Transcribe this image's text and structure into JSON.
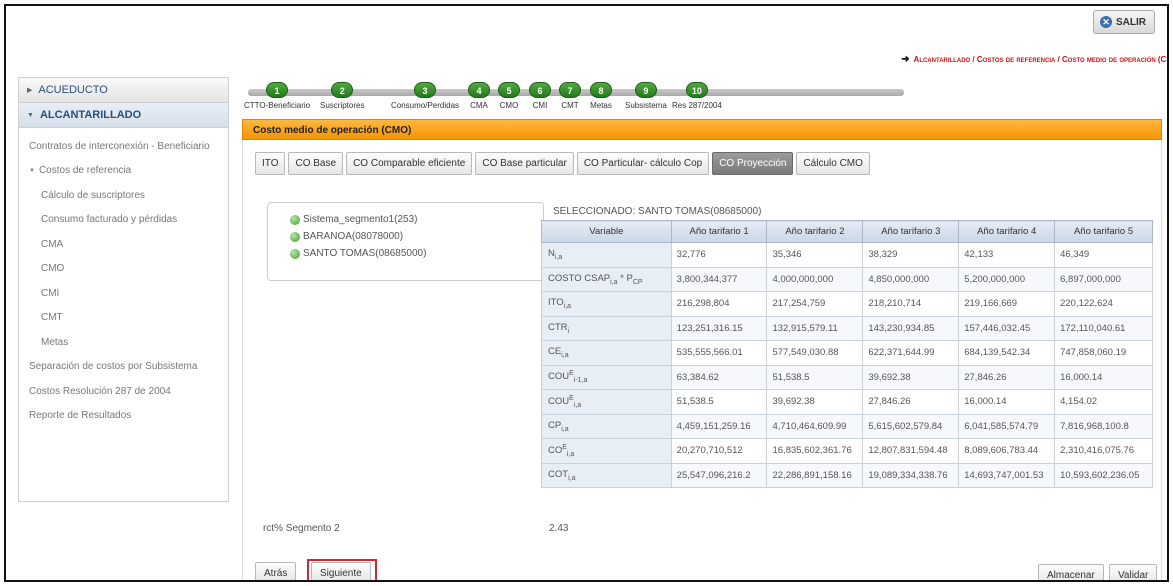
{
  "header": {
    "exit_label": "SALIR"
  },
  "breadcrumb": {
    "text": "Alcantarillado / Costos de referencia / Costo medio de operación (CM"
  },
  "sidebar": {
    "sections": [
      {
        "label": "ACUEDUCTO",
        "expanded": false
      },
      {
        "label": "ALCANTARILLADO",
        "expanded": true
      }
    ],
    "items": [
      {
        "label": "Contratos de interconexión - Beneficiario",
        "level": 0
      },
      {
        "label": "Costos de referencia",
        "level": 0
      },
      {
        "label": "Cálculo de suscriptores",
        "level": 1
      },
      {
        "label": "Consumo facturado y pérdidas",
        "level": 1
      },
      {
        "label": "CMA",
        "level": 1
      },
      {
        "label": "CMO",
        "level": 1
      },
      {
        "label": "CMI",
        "level": 1
      },
      {
        "label": "CMT",
        "level": 1
      },
      {
        "label": "Metas",
        "level": 1
      },
      {
        "label": "Separación de costos por Subsistema",
        "level": 0
      },
      {
        "label": "Costos Resolución 287 de 2004",
        "level": 0
      },
      {
        "label": "Reporte de Resultados",
        "level": 0
      }
    ]
  },
  "steps": [
    {
      "num": "1",
      "label": "CTTO-Beneficiario"
    },
    {
      "num": "2",
      "label": "Suscriptores"
    },
    {
      "num": "3",
      "label": "Consumo/Perdidas"
    },
    {
      "num": "4",
      "label": "CMA"
    },
    {
      "num": "5",
      "label": "CMO"
    },
    {
      "num": "6",
      "label": "CMI"
    },
    {
      "num": "7",
      "label": "CMT"
    },
    {
      "num": "8",
      "label": "Metas"
    },
    {
      "num": "9",
      "label": "Subsistema"
    },
    {
      "num": "10",
      "label": "Res 287/2004"
    }
  ],
  "panel": {
    "title": "Costo medio de operación (CMO)"
  },
  "tabs": [
    {
      "label": "ITO",
      "active": false
    },
    {
      "label": "CO Base",
      "active": false
    },
    {
      "label": "CO Comparable eficiente",
      "active": false
    },
    {
      "label": "CO Base particular",
      "active": false
    },
    {
      "label": "CO Particular- cálculo Cop",
      "active": false
    },
    {
      "label": "CO Proyección",
      "active": true
    },
    {
      "label": "Cálculo CMO",
      "active": false
    }
  ],
  "tree": {
    "nodes": [
      "Sistema_segmento1(253)",
      "BARANOA(08078000)",
      "SANTO TOMAS(08685000)"
    ]
  },
  "table": {
    "selected_label": "SELECCIONADO: SANTO TOMAS(08685000)",
    "headers": [
      "Variable",
      "Año tarifario 1",
      "Año tarifario 2",
      "Año tarifario 3",
      "Año tarifario 4",
      "Año tarifario 5"
    ],
    "rows": [
      {
        "var_main": "N",
        "var_sub": "i,a",
        "var_suffix": "",
        "values": [
          "32,776",
          "35,346",
          "38,329",
          "42,133",
          "46,349"
        ]
      },
      {
        "var_main": "COSTO CSAP",
        "var_sub": "i,a",
        "var_suffix": " * P",
        "var_sub2": "CP",
        "values": [
          "3,800,344,377",
          "4,000,000,000",
          "4,850,000,000",
          "5,200,000,000",
          "6,897,000,000"
        ]
      },
      {
        "var_main": "ITO",
        "var_sub": "i,a",
        "var_suffix": "",
        "values": [
          "216,298,804",
          "217,254,759",
          "218,210,714",
          "219,166,669",
          "220,122,624"
        ]
      },
      {
        "var_main": "CTR",
        "var_sub": "i",
        "var_suffix": "",
        "values": [
          "123,251,316.15",
          "132,915,579.11",
          "143,230,934.85",
          "157,446,032.45",
          "172,110,040.61"
        ]
      },
      {
        "var_main": "CE",
        "var_sub": "i,a",
        "var_suffix": "",
        "values": [
          "535,555,566.01",
          "577,549,030.88",
          "622,371,644.99",
          "684,139,542.34",
          "747,858,060.19"
        ]
      },
      {
        "var_main": "COU",
        "var_sup": "E",
        "var_sub": "i-1,a",
        "var_suffix": "",
        "values": [
          "63,384.62",
          "51,538.5",
          "39,692.38",
          "27,846.26",
          "16,000.14"
        ]
      },
      {
        "var_main": "COU",
        "var_sup": "E",
        "var_sub": "i,a",
        "var_suffix": "",
        "values": [
          "51,538.5",
          "39,692.38",
          "27,846.26",
          "16,000.14",
          "4,154.02"
        ]
      },
      {
        "var_main": "CP",
        "var_sub": "i,a",
        "var_suffix": "",
        "values": [
          "4,459,151,259.16",
          "4,710,464,609.99",
          "5,615,602,579.84",
          "6,041,585,574.79",
          "7,816,968,100.8"
        ]
      },
      {
        "var_main": "CO",
        "var_sup": "E",
        "var_sub": "i,a",
        "var_suffix": "",
        "values": [
          "20,270,710,512",
          "16,835,602,361.76",
          "12,807,831,594.48",
          "8,089,606,783.44",
          "2,310,416,075.76"
        ]
      },
      {
        "var_main": "COT",
        "var_sub": "i,a",
        "var_suffix": "",
        "values": [
          "25,547,096,216.2",
          "22,286,891,158.16",
          "19,089,334,338.76",
          "14,693,747,001.53",
          "10,593,602,236.05"
        ]
      }
    ]
  },
  "rct": {
    "label": "rct% Segmento 2",
    "value": "2.43"
  },
  "buttons": {
    "back": "Atrás",
    "next": "Siguiente",
    "save": "Almacenar",
    "validate": "Validar"
  },
  "colors": {
    "accent_orange": "#f49300",
    "step_green": "#247a1b",
    "highlight_red": "#d9242b",
    "breadcrumb_red": "#c81414"
  }
}
